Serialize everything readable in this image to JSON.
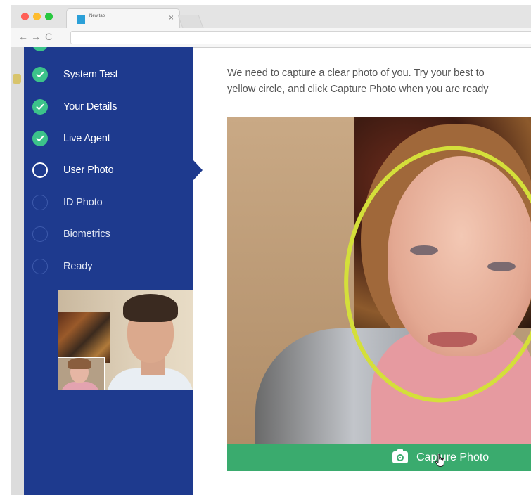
{
  "browser": {
    "tab_title": "New tab",
    "tab_close": "×",
    "nav_back": "←",
    "nav_forward": "→",
    "nav_reload": "C"
  },
  "sidebar": {
    "steps": [
      {
        "label": "System Test",
        "status": "done"
      },
      {
        "label": "Your Details",
        "status": "done"
      },
      {
        "label": "Live Agent",
        "status": "done"
      },
      {
        "label": "User Photo",
        "status": "current"
      },
      {
        "label": "ID Photo",
        "status": "pending"
      },
      {
        "label": "Biometrics",
        "status": "pending"
      },
      {
        "label": "Ready",
        "status": "pending"
      }
    ]
  },
  "main": {
    "instructions_line1": "We need to capture a clear photo of you. Try your best to",
    "instructions_line2": "yellow circle, and click Capture Photo when you are ready",
    "capture_label": "Capture Photo"
  },
  "colors": {
    "sidebar_bg": "#1e3a8e",
    "done_green": "#3cc38a",
    "capture_green": "#3aab6e",
    "face_ring": "#d4df3a"
  }
}
